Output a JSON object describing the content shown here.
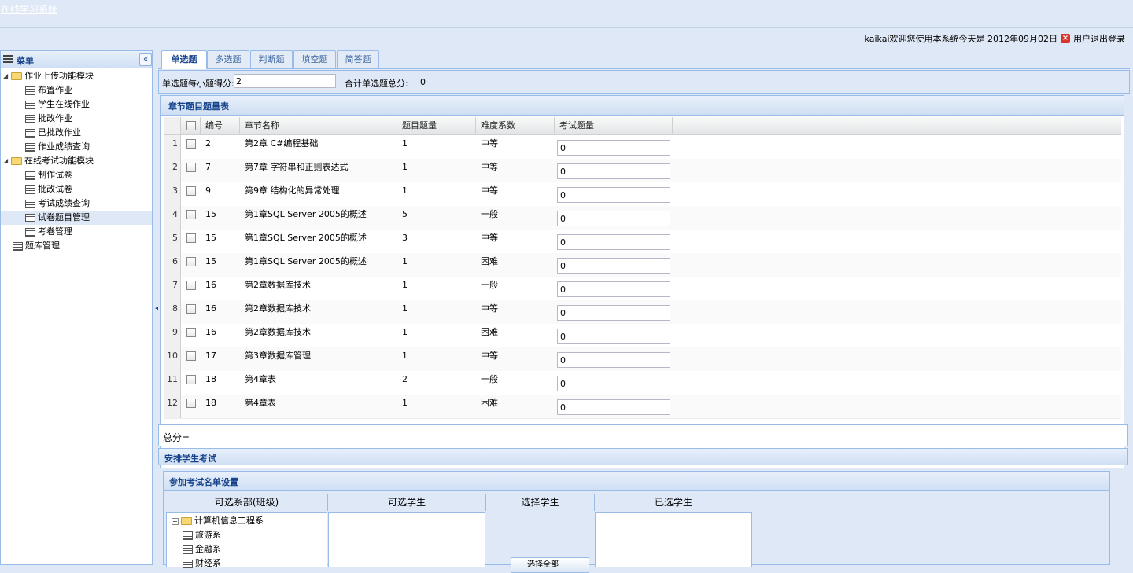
{
  "app": {
    "title": "在线学习系统"
  },
  "userbar": {
    "text": "kaikai欢迎您使用本系统今天是  2012年09月02日",
    "logout": "用户退出登录"
  },
  "sidebar": {
    "title": "菜单",
    "groups": [
      {
        "label": "作业上传功能模块",
        "items": [
          "布置作业",
          "学生在线作业",
          "批改作业",
          "已批改作业",
          "作业成绩查询"
        ]
      },
      {
        "label": "在线考试功能模块",
        "items": [
          "制作试卷",
          "批改试卷",
          "考试成绩查询",
          "试卷题目管理",
          "考卷管理"
        ]
      }
    ],
    "extra_item": "题库管理"
  },
  "tabs": [
    "单选题",
    "多选题",
    "判断题",
    "填空题",
    "简答题"
  ],
  "form": {
    "score_label": "单选题每小题得分:",
    "score_value": "2",
    "total_label": "合计单选题总分:",
    "total_value": "0"
  },
  "grid": {
    "title": "章节题目题量表",
    "columns": [
      "编号",
      "章节名称",
      "题目题量",
      "难度系数",
      "考试题量"
    ],
    "rows": [
      {
        "n": "1",
        "id": "2",
        "name": "第2章  C#编程基础",
        "count": "1",
        "difficulty": "中等",
        "exam": "0"
      },
      {
        "n": "2",
        "id": "7",
        "name": "第7章  字符串和正则表达式",
        "count": "1",
        "difficulty": "中等",
        "exam": "0"
      },
      {
        "n": "3",
        "id": "9",
        "name": "第9章  结构化的异常处理",
        "count": "1",
        "difficulty": "中等",
        "exam": "0"
      },
      {
        "n": "4",
        "id": "15",
        "name": "第1章SQL Server 2005的概述",
        "count": "5",
        "difficulty": "一般",
        "exam": "0"
      },
      {
        "n": "5",
        "id": "15",
        "name": "第1章SQL Server 2005的概述",
        "count": "3",
        "difficulty": "中等",
        "exam": "0"
      },
      {
        "n": "6",
        "id": "15",
        "name": "第1章SQL Server 2005的概述",
        "count": "1",
        "difficulty": "困难",
        "exam": "0"
      },
      {
        "n": "7",
        "id": "16",
        "name": "第2章数据库技术",
        "count": "1",
        "difficulty": "一般",
        "exam": "0"
      },
      {
        "n": "8",
        "id": "16",
        "name": "第2章数据库技术",
        "count": "1",
        "difficulty": "中等",
        "exam": "0"
      },
      {
        "n": "9",
        "id": "16",
        "name": "第2章数据库技术",
        "count": "1",
        "difficulty": "困难",
        "exam": "0"
      },
      {
        "n": "10",
        "id": "17",
        "name": "第3章数据库管理",
        "count": "1",
        "difficulty": "中等",
        "exam": "0"
      },
      {
        "n": "11",
        "id": "18",
        "name": "第4章表",
        "count": "2",
        "difficulty": "一般",
        "exam": "0"
      },
      {
        "n": "12",
        "id": "18",
        "name": "第4章表",
        "count": "1",
        "difficulty": "困难",
        "exam": "0"
      }
    ]
  },
  "sum": {
    "label": "总分="
  },
  "arrange": {
    "title": "安排学生考试"
  },
  "attend": {
    "title": "参加考试名单设置",
    "columns": [
      "可选系部(班级)",
      "可选学生",
      "选择学生",
      "已选学生"
    ],
    "departments": [
      "计算机信息工程系",
      "旅游系",
      "金融系",
      "财经系"
    ],
    "select_all": "选择全部"
  }
}
